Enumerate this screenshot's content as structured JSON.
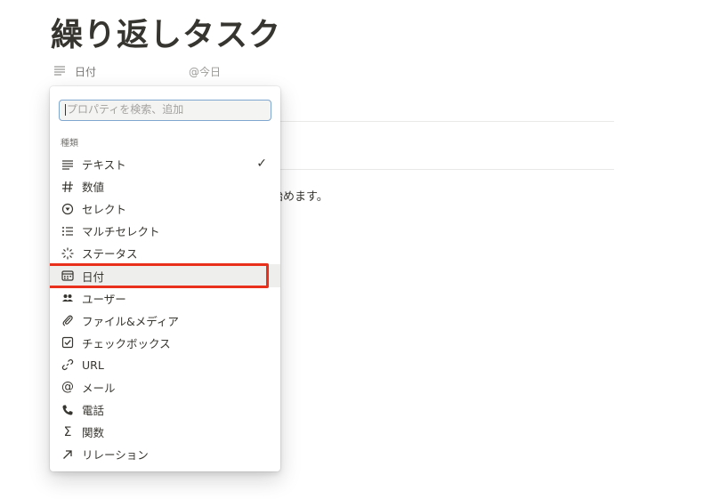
{
  "page": {
    "title": "繰り返しタスク"
  },
  "property": {
    "name": "日付",
    "value": "@今日"
  },
  "body_text": "始めます。",
  "menu": {
    "search_placeholder": "プロパティを検索、追加",
    "section_label": "種類",
    "checked_item": "テキスト",
    "selected_item": "日付",
    "items": [
      {
        "label": "テキスト",
        "icon": "text-lines-icon"
      },
      {
        "label": "数値",
        "icon": "hash-icon"
      },
      {
        "label": "セレクト",
        "icon": "select-circle-icon"
      },
      {
        "label": "マルチセレクト",
        "icon": "list-icon"
      },
      {
        "label": "ステータス",
        "icon": "status-loader-icon"
      },
      {
        "label": "日付",
        "icon": "calendar-icon"
      },
      {
        "label": "ユーザー",
        "icon": "people-icon"
      },
      {
        "label": "ファイル&メディア",
        "icon": "paperclip-icon"
      },
      {
        "label": "チェックボックス",
        "icon": "checkbox-icon"
      },
      {
        "label": "URL",
        "icon": "link-icon"
      },
      {
        "label": "メール",
        "icon": "at-icon"
      },
      {
        "label": "電話",
        "icon": "phone-icon"
      },
      {
        "label": "関数",
        "icon": "sigma-icon"
      },
      {
        "label": "リレーション",
        "icon": "arrow-up-right-icon"
      }
    ]
  },
  "colors": {
    "highlight": "#e8301c",
    "search_border": "#7fa6cf"
  }
}
